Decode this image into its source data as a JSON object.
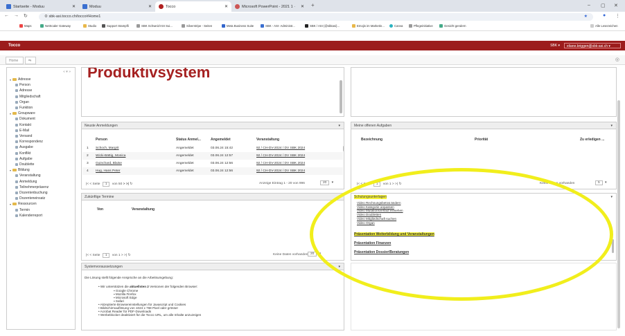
{
  "browser": {
    "tabs": [
      {
        "label": "Startseite - Moduu",
        "active": false
      },
      {
        "label": "Moduu",
        "active": false
      },
      {
        "label": "Tocco",
        "active": true
      },
      {
        "label": "Microsoft PowerPoint - 2021 1 ·",
        "active": false
      }
    ],
    "new_tab": "+",
    "url": "sbk-asi.tocco.ch/tocco#Home1",
    "bookmarks": [
      "Maps",
      "NetScaler Gateway",
      "Studio",
      "Support Stampfli",
      "SBK Schweiz/ASI Sui...",
      "Silverstripe - Seiten",
      "Meta Business Suite",
      "SBK - ASI- Administr...",
      "SBK / ASI (@sbkasi)...",
      "Emojis im Marketin...",
      "Canva",
      "Pflegeinitiative",
      "Gesicht gendern"
    ],
    "bookmarks_right": "Alle Lesezeichen"
  },
  "app": {
    "title": "Tocco",
    "sbk": "SBK ▾",
    "user": "eliane.briggen@sbk-asi.ch ▾",
    "home_tab": "Home"
  },
  "tree": [
    {
      "label": "Adresse",
      "level": 0
    },
    {
      "label": "Person",
      "level": 1
    },
    {
      "label": "Adresse",
      "level": 1
    },
    {
      "label": "Mitgliedschaft",
      "level": 1
    },
    {
      "label": "Organ",
      "level": 1
    },
    {
      "label": "Funktion",
      "level": 1
    },
    {
      "label": "Groupware",
      "level": 0
    },
    {
      "label": "Dokument",
      "level": 1
    },
    {
      "label": "Kontakt",
      "level": 1
    },
    {
      "label": "E-Mail",
      "level": 1
    },
    {
      "label": "Versand",
      "level": 1
    },
    {
      "label": "Korrespondenz",
      "level": 1
    },
    {
      "label": "Ausgabe",
      "level": 1
    },
    {
      "label": "Konflikt",
      "level": 1
    },
    {
      "label": "Aufgabe",
      "level": 1
    },
    {
      "label": "Doublette",
      "level": 1
    },
    {
      "label": "Bildung",
      "level": 0
    },
    {
      "label": "Veranstaltung",
      "level": 1
    },
    {
      "label": "Anmeldung",
      "level": 1
    },
    {
      "label": "Teilnehmerpräsenz",
      "level": 1
    },
    {
      "label": "Dozentenbuchung",
      "level": 1
    },
    {
      "label": "Dozenteneinsatz",
      "level": 1
    },
    {
      "label": "Ressourcen",
      "level": 0
    },
    {
      "label": "Termin",
      "level": 1
    },
    {
      "label": "Kalenderreport",
      "level": 1
    }
  ],
  "hero": {
    "text": "Produktivsystem"
  },
  "anmeldungen": {
    "title": "Neuste Anmeldungen",
    "columns": [
      "Person",
      "Status Anmel...",
      "Angemeldet",
      "Veranstaltung"
    ],
    "rows": [
      {
        "n": "1",
        "person": "Schoch, Margrit",
        "status": "Angemeldet",
        "date": "03.06.24 15:42",
        "event": "92 / CH-DV-2024 / DV SBK 2024"
      },
      {
        "n": "2",
        "person": "Wicki-Bättig, Monica",
        "status": "Angemeldet",
        "date": "03.06.24 12:57",
        "event": "92 / CH-DV-2024 / DV SBK 2024"
      },
      {
        "n": "3",
        "person": "Guinchard, Blaise",
        "status": "Angemeldet",
        "date": "03.06.24 12:56",
        "event": "92 / CH-DV-2024 / DV SBK 2024"
      },
      {
        "n": "4",
        "person": "Hug, Hans Peter",
        "status": "Angemeldet",
        "date": "03.06.24 12:56",
        "event": "92 / CH-DV-2024 / DV SBK 2024"
      }
    ],
    "pager": {
      "seite": "Seite",
      "page": "1",
      "of": "von 50",
      "info": "Anzeige Eintrag 1 - 20 von 996",
      "per": "20"
    }
  },
  "aufgaben": {
    "title": "Meine offenen Aufgaben",
    "columns": [
      "Bezeichnung",
      "Priorität",
      "Zu erledigen ..."
    ],
    "pager": {
      "seite": "Seite",
      "page": "1",
      "of": "von 1",
      "info": "Keine Daten vorhanden",
      "per": "5"
    }
  },
  "termine": {
    "title": "Zukünftige Termine",
    "columns": [
      "Von",
      "Veranstaltung"
    ],
    "pager": {
      "seite": "Seite",
      "page": "1",
      "of": "von 1",
      "info": "Keine Daten vorhanden",
      "per": "20"
    }
  },
  "schulung": {
    "title": "Schulungsunterlagen",
    "links": [
      "Video Rechnungsbetrat ändern",
      "Video Kategorie anpassen",
      "Video Mutationsverlauf einsehen",
      "Video Doubletten",
      "Video Mitgliedschaft suchen",
      "Video Organ"
    ],
    "sections": [
      "Präsentation Weiterbildung und Veranstaltungen",
      "Präsentation Finanzen",
      "Präsentation Dossier/Beratungen"
    ]
  },
  "system": {
    "title": "Systemvoraussetzungen",
    "intro": "Die Lösung stellt folgende Ansprüche an die Arbeitsumgebung:",
    "browser_pre": "Wir unterstützen die ",
    "browser_bold": "aktuellsten 2",
    "browser_post": " Versionen der folgenden Browser:",
    "browsers": [
      "Google Chrome",
      "Mozilla Firefox",
      "Microsoft Edge",
      "Safari"
    ],
    "items": [
      "Akzeptierte Browsereinstellungen für Javascript und Cookies",
      "Bildschirmauflösung von 1024 x 768 Pixel oder grösser",
      "Acrobat Reader für PDF-Downloads",
      "Werbeblocker deaktiviert für die Tocco URL, um alle Inhalte anzuzeigen"
    ]
  }
}
